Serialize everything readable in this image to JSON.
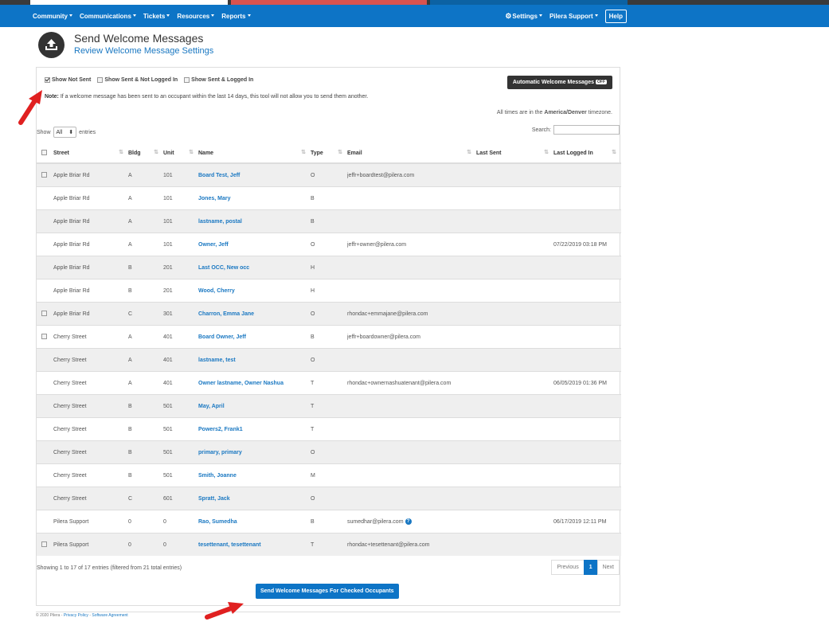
{
  "nav": {
    "left": [
      "Community",
      "Communications",
      "Tickets",
      "Resources",
      "Reports"
    ],
    "settings": "Settings",
    "user": "Pilera Support",
    "help": "Help"
  },
  "header": {
    "title": "Send Welcome Messages",
    "link": "Review Welcome Message Settings"
  },
  "filters": {
    "not_sent": "Show Not Sent",
    "sent_not_logged": "Show Sent & Not Logged In",
    "sent_logged": "Show Sent & Logged In"
  },
  "auto_button": {
    "label": "Automatic Welcome Messages",
    "state": "OFF"
  },
  "note": {
    "label": "Note:",
    "text": " If a welcome message has been sent to an occupant within the last 14 days, this tool will not allow you to send them another."
  },
  "timezone": {
    "prefix": "All times are in the ",
    "zone": "America/Denver",
    "suffix": " timezone."
  },
  "show_entries": {
    "show": "Show",
    "value": "All",
    "entries": "entries"
  },
  "search_label": "Search:",
  "columns": [
    "",
    "Street",
    "Bldg",
    "Unit",
    "Name",
    "Type",
    "Email",
    "Last Sent",
    "Last Logged In"
  ],
  "rows": [
    {
      "cb": true,
      "street": "Apple Briar Rd",
      "bldg": "A",
      "unit": "101",
      "name": "Board Test, Jeff",
      "type": "O",
      "email": "jeffr+boardtest@pilera.com",
      "sent": "",
      "logged": ""
    },
    {
      "cb": false,
      "street": "Apple Briar Rd",
      "bldg": "A",
      "unit": "101",
      "name": "Jones, Mary",
      "type": "B",
      "email": "",
      "sent": "",
      "logged": ""
    },
    {
      "cb": false,
      "street": "Apple Briar Rd",
      "bldg": "A",
      "unit": "101",
      "name": "lastname, postal",
      "type": "B",
      "email": "",
      "sent": "",
      "logged": ""
    },
    {
      "cb": false,
      "street": "Apple Briar Rd",
      "bldg": "A",
      "unit": "101",
      "name": "Owner, Jeff",
      "type": "O",
      "email": "jeffr+owner@pilera.com",
      "sent": "",
      "logged": "07/22/2019 03:18 PM"
    },
    {
      "cb": false,
      "street": "Apple Briar Rd",
      "bldg": "B",
      "unit": "201",
      "name": "Last OCC, New occ",
      "type": "H",
      "email": "",
      "sent": "",
      "logged": ""
    },
    {
      "cb": false,
      "street": "Apple Briar Rd",
      "bldg": "B",
      "unit": "201",
      "name": "Wood, Cherry",
      "type": "H",
      "email": "",
      "sent": "",
      "logged": ""
    },
    {
      "cb": true,
      "street": "Apple Briar Rd",
      "bldg": "C",
      "unit": "301",
      "name": "Charron, Emma Jane",
      "type": "O",
      "email": "rhondac+emmajane@pilera.com",
      "sent": "",
      "logged": ""
    },
    {
      "cb": true,
      "street": "Cherry Street",
      "bldg": "A",
      "unit": "401",
      "name": "Board Owner, Jeff",
      "type": "B",
      "email": "jeffr+boardowner@pilera.com",
      "sent": "",
      "logged": ""
    },
    {
      "cb": false,
      "street": "Cherry Street",
      "bldg": "A",
      "unit": "401",
      "name": "lastname, test",
      "type": "O",
      "email": "",
      "sent": "",
      "logged": ""
    },
    {
      "cb": false,
      "street": "Cherry Street",
      "bldg": "A",
      "unit": "401",
      "name": "Owner lastname, Owner Nashua",
      "type": "T",
      "email": "rhondac+ownernashuatenant@pilera.com",
      "sent": "",
      "logged": "06/05/2019 01:36 PM"
    },
    {
      "cb": false,
      "street": "Cherry Street",
      "bldg": "B",
      "unit": "501",
      "name": "May, April",
      "type": "T",
      "email": "",
      "sent": "",
      "logged": ""
    },
    {
      "cb": false,
      "street": "Cherry Street",
      "bldg": "B",
      "unit": "501",
      "name": "Powers2, Frank1",
      "type": "T",
      "email": "",
      "sent": "",
      "logged": ""
    },
    {
      "cb": false,
      "street": "Cherry Street",
      "bldg": "B",
      "unit": "501",
      "name": "primary, primary",
      "type": "O",
      "email": "",
      "sent": "",
      "logged": ""
    },
    {
      "cb": false,
      "street": "Cherry Street",
      "bldg": "B",
      "unit": "501",
      "name": "Smith, Joanne",
      "type": "M",
      "email": "",
      "sent": "",
      "logged": ""
    },
    {
      "cb": false,
      "street": "Cherry Street",
      "bldg": "C",
      "unit": "601",
      "name": "Spratt, Jack",
      "type": "O",
      "email": "",
      "sent": "",
      "logged": ""
    },
    {
      "cb": false,
      "street": "Pilera Support",
      "bldg": "0",
      "unit": "0",
      "name": "Rao, Sumedha",
      "type": "B",
      "email": "sumedhar@pilera.com",
      "sent": "",
      "logged": "06/17/2019 12:11 PM",
      "help": "?"
    },
    {
      "cb": true,
      "street": "Pilera Support",
      "bldg": "0",
      "unit": "0",
      "name": "tesettenant, tesettenant",
      "type": "T",
      "email": "rhondac+tesettenant@pilera.com",
      "sent": "",
      "logged": ""
    }
  ],
  "info": "Showing 1 to 17 of 17 entries (filtered from 21 total entries)",
  "pager": {
    "prev": "Previous",
    "page": "1",
    "next": "Next"
  },
  "send_button": "Send Welcome Messages For Checked Occupants",
  "footer": {
    "copy": "© 2020 Pilera - ",
    "privacy": "Privacy Policy",
    "sep": " - ",
    "agreement": "Software Agreement"
  },
  "colors": {
    "nav": "#0d74c6",
    "link": "#1a78c2",
    "arrow": "#e02020"
  }
}
